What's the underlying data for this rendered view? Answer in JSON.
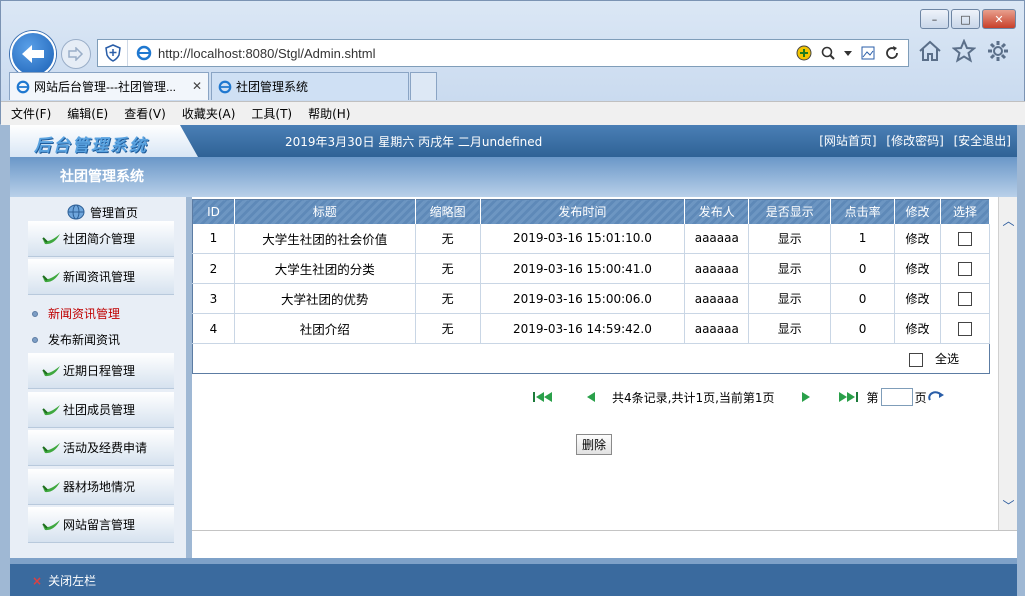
{
  "window": {
    "minimize": "–",
    "restore": "□",
    "close": "✕"
  },
  "address": {
    "url": "http://localhost:8080/Stgl/Admin.shtml"
  },
  "tabs": [
    {
      "label": "网站后台管理---社团管理...",
      "close": "✕"
    },
    {
      "label": "社团管理系统"
    }
  ],
  "menu": [
    "文件(F)",
    "编辑(E)",
    "查看(V)",
    "收藏夹(A)",
    "工具(T)",
    "帮助(H)"
  ],
  "header": {
    "logo": "后台管理系统",
    "date": "2019年3月30日 星期六 丙戌年 二月undefined",
    "links": [
      "[网站首页]",
      "[修改密码]",
      "[安全退出]"
    ],
    "system_title": "社团管理系统"
  },
  "sidebar": {
    "home": "管理首页",
    "items": [
      "社团简介管理",
      "新闻资讯管理",
      "近期日程管理",
      "社团成员管理",
      "活动及经费申请",
      "器材场地情况",
      "网站留言管理"
    ],
    "subitems": [
      "新闻资讯管理",
      "发布新闻资讯"
    ]
  },
  "table": {
    "headers": [
      "ID",
      "标题",
      "缩略图",
      "发布时间",
      "发布人",
      "是否显示",
      "点击率",
      "修改",
      "选择"
    ],
    "rows": [
      {
        "id": "1",
        "title": "大学生社团的社会价值",
        "thumb": "无",
        "time": "2019-03-16 15:01:10.0",
        "author": "aaaaaa",
        "show": "显示",
        "clicks": "1",
        "edit": "修改"
      },
      {
        "id": "2",
        "title": "大学生社团的分类",
        "thumb": "无",
        "time": "2019-03-16 15:00:41.0",
        "author": "aaaaaa",
        "show": "显示",
        "clicks": "0",
        "edit": "修改"
      },
      {
        "id": "3",
        "title": "大学社团的优势",
        "thumb": "无",
        "time": "2019-03-16 15:00:06.0",
        "author": "aaaaaa",
        "show": "显示",
        "clicks": "0",
        "edit": "修改"
      },
      {
        "id": "4",
        "title": "社团介绍",
        "thumb": "无",
        "time": "2019-03-16 14:59:42.0",
        "author": "aaaaaa",
        "show": "显示",
        "clicks": "0",
        "edit": "修改"
      }
    ],
    "select_all": "全选"
  },
  "pager": {
    "info": "共4条记录,共计1页,当前第1页",
    "page_prefix": "第",
    "page_suffix": "页",
    "page_value": ""
  },
  "actions": {
    "delete": "删除"
  },
  "footer": {
    "close_left": "关闭左栏"
  },
  "colors": {
    "header_blue": "#2f6296",
    "link_red": "#c00000"
  }
}
